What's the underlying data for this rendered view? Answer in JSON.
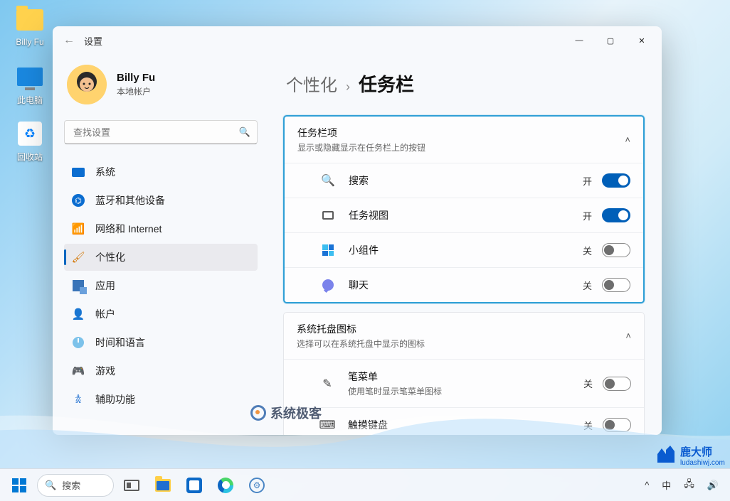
{
  "desktop": {
    "icons": [
      {
        "label": "Billy Fu"
      },
      {
        "label": "此电脑"
      },
      {
        "label": "回收站"
      }
    ]
  },
  "window": {
    "app_title": "设置",
    "profile": {
      "name": "Billy Fu",
      "subtitle": "本地帐户"
    },
    "search_placeholder": "查找设置",
    "nav": [
      {
        "label": "系统"
      },
      {
        "label": "蓝牙和其他设备"
      },
      {
        "label": "网络和 Internet"
      },
      {
        "label": "个性化"
      },
      {
        "label": "应用"
      },
      {
        "label": "帐户"
      },
      {
        "label": "时间和语言"
      },
      {
        "label": "游戏"
      },
      {
        "label": "辅助功能"
      }
    ],
    "breadcrumb": {
      "parent": "个性化",
      "current": "任务栏"
    },
    "sections": [
      {
        "title": "任务栏项",
        "desc": "显示或隐藏显示在任务栏上的按钮",
        "items": [
          {
            "label": "搜索",
            "state": "开",
            "on": true
          },
          {
            "label": "任务视图",
            "state": "开",
            "on": true
          },
          {
            "label": "小组件",
            "state": "关",
            "on": false
          },
          {
            "label": "聊天",
            "state": "关",
            "on": false
          }
        ]
      },
      {
        "title": "系统托盘图标",
        "desc": "选择可以在系统托盘中显示的图标",
        "items": [
          {
            "label": "笔菜单",
            "desc": "使用笔时显示笔菜单图标",
            "state": "关",
            "on": false
          },
          {
            "label": "触摸键盘",
            "state": "关",
            "on": false
          }
        ]
      }
    ]
  },
  "taskbar": {
    "search_label": "搜索",
    "ime": "中",
    "tray_up": "^"
  },
  "watermarks": {
    "w1": "系统极客",
    "w2a": "鹿大师",
    "w2b": "ludashiwj.com"
  }
}
